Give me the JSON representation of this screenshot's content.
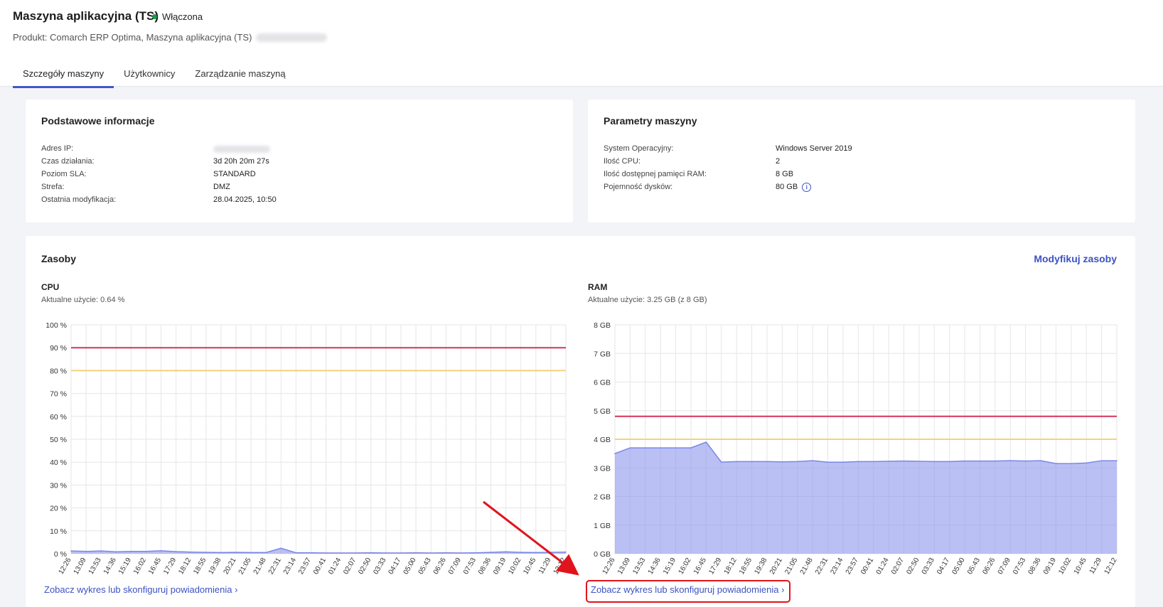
{
  "header": {
    "title": "Maszyna aplikacyjna (TS)",
    "status": "Włączona",
    "product_prefix": "Produkt: Comarch ERP Optima, Maszyna aplikacyjna (TS)"
  },
  "tabs": [
    {
      "label": "Szczegóły maszyny",
      "active": true
    },
    {
      "label": "Użytkownicy",
      "active": false
    },
    {
      "label": "Zarządzanie maszyną",
      "active": false
    }
  ],
  "basic_info": {
    "title": "Podstawowe informacje",
    "rows": [
      {
        "label": "Adres IP:",
        "value": ""
      },
      {
        "label": "Czas działania:",
        "value": "3d 20h 20m 27s"
      },
      {
        "label": "Poziom SLA:",
        "value": "STANDARD"
      },
      {
        "label": "Strefa:",
        "value": "DMZ"
      },
      {
        "label": "Ostatnia modyfikacja:",
        "value": "28.04.2025, 10:50"
      }
    ]
  },
  "machine_params": {
    "title": "Parametry maszyny",
    "rows": [
      {
        "label": "System Operacyjny:",
        "value": "Windows Server 2019"
      },
      {
        "label": "Ilość CPU:",
        "value": "2"
      },
      {
        "label": "Ilość dostępnej pamięci RAM:",
        "value": "8 GB"
      },
      {
        "label": "Pojemność dysków:",
        "value": "80 GB"
      }
    ]
  },
  "resources": {
    "title": "Zasoby",
    "modify_label": "Modyfikuj zasoby",
    "cpu": {
      "title": "CPU",
      "usage": "Aktualne użycie: 0.64 %",
      "link": "Zobacz wykres lub skonfiguruj powiadomienia"
    },
    "ram": {
      "title": "RAM",
      "usage": "Aktualne użycie: 3.25 GB (z 8 GB)",
      "link": "Zobacz wykres lub skonfiguruj powiadomienia"
    }
  },
  "chart_data": [
    {
      "type": "area",
      "title": "CPU",
      "ylim": [
        0,
        100
      ],
      "yticks": [
        "0 %",
        "10 %",
        "20 %",
        "30 %",
        "40 %",
        "50 %",
        "60 %",
        "70 %",
        "80 %",
        "90 %",
        "100 %"
      ],
      "x": [
        "12:26",
        "13:09",
        "13:53",
        "14:36",
        "15:19",
        "16:02",
        "16:45",
        "17:29",
        "18:12",
        "18:55",
        "19:38",
        "20:21",
        "21:05",
        "21:48",
        "22:31",
        "23:14",
        "23:57",
        "00:41",
        "01:24",
        "02:07",
        "02:50",
        "03:33",
        "04:17",
        "05:00",
        "05:43",
        "06:26",
        "07:09",
        "07:53",
        "08:36",
        "09:19",
        "10:02",
        "10:45",
        "11:29",
        "12:12"
      ],
      "values": [
        1.2,
        1.0,
        1.2,
        0.8,
        1.0,
        1.0,
        1.3,
        0.9,
        0.7,
        0.6,
        0.5,
        0.6,
        0.5,
        0.5,
        2.4,
        0.4,
        0.4,
        0.3,
        0.3,
        0.3,
        0.4,
        0.3,
        0.3,
        0.4,
        0.3,
        0.4,
        0.3,
        0.4,
        0.6,
        0.8,
        0.6,
        0.5,
        0.6,
        0.7
      ],
      "threshold_lines": [
        {
          "value": 90,
          "color": "#d6335a"
        },
        {
          "value": 80,
          "color": "#f5d27a"
        }
      ],
      "grid": true
    },
    {
      "type": "area",
      "title": "RAM",
      "ylim": [
        0,
        8
      ],
      "yticks": [
        "0 GB",
        "1 GB",
        "2 GB",
        "3 GB",
        "4 GB",
        "5 GB",
        "6 GB",
        "7 GB",
        "8 GB"
      ],
      "x": [
        "12:26",
        "13:09",
        "13:53",
        "14:36",
        "15:19",
        "16:02",
        "16:45",
        "17:29",
        "18:12",
        "18:55",
        "19:38",
        "20:21",
        "21:05",
        "21:48",
        "22:31",
        "23:14",
        "23:57",
        "00:41",
        "01:24",
        "02:07",
        "02:50",
        "03:33",
        "04:17",
        "05:00",
        "05:43",
        "06:26",
        "07:09",
        "07:53",
        "08:36",
        "09:19",
        "10:02",
        "10:45",
        "11:29",
        "12:12"
      ],
      "values": [
        3.5,
        3.7,
        3.7,
        3.7,
        3.7,
        3.7,
        3.9,
        3.2,
        3.22,
        3.22,
        3.22,
        3.21,
        3.22,
        3.25,
        3.2,
        3.2,
        3.22,
        3.22,
        3.23,
        3.24,
        3.23,
        3.22,
        3.22,
        3.24,
        3.24,
        3.24,
        3.25,
        3.24,
        3.25,
        3.15,
        3.15,
        3.17,
        3.25,
        3.25
      ],
      "threshold_lines": [
        {
          "value": 4.8,
          "color": "#d6335a"
        },
        {
          "value": 4.0,
          "color": "#f5d27a"
        }
      ],
      "grid": true
    }
  ]
}
